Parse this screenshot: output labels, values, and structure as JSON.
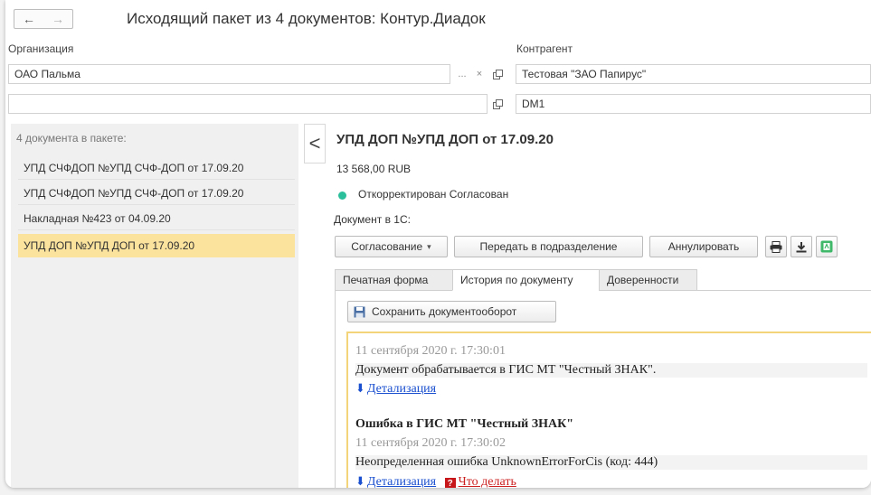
{
  "header": {
    "title": "Исходящий пакет из 4 документов: Контур.Диадок",
    "back_icon": "arrow-left-icon",
    "forward_icon": "arrow-right-icon"
  },
  "organization": {
    "label": "Организация",
    "value": "ОАО Пальма",
    "ellipsis": "...",
    "clear": "×"
  },
  "counterparty": {
    "label": "Контрагент",
    "value": "Тестовая \"ЗАО Папирус\"",
    "second_value": "DM1"
  },
  "package": {
    "header": "4 документа в пакете:",
    "items": [
      {
        "label": "УПД СЧФДОП №УПД СЧФ-ДОП от 17.09.20"
      },
      {
        "label": "УПД СЧФДОП №УПД СЧФ-ДОП от 17.09.20"
      },
      {
        "label": "Накладная  №423 от 04.09.20"
      },
      {
        "label": "УПД ДОП №УПД ДОП от 17.09.20"
      }
    ],
    "collapse": "<"
  },
  "document": {
    "title": "УПД ДОП №УПД ДОП от 17.09.20",
    "amount": "13 568,00  RUB",
    "status": "Откорректирован  Согласован",
    "status_color": "#2bbf9c",
    "doc_1c_label": "Документ в 1С:"
  },
  "toolbar": {
    "approval": "Согласование",
    "transfer": "Передать в подразделение",
    "annul": "Аннулировать",
    "print_icon": "printer-icon",
    "download_icon": "download-icon",
    "green_icon": "document-green-icon"
  },
  "tabs": [
    {
      "label": "Печатная форма"
    },
    {
      "label": "История по документу"
    },
    {
      "label": "Доверенности"
    }
  ],
  "history": {
    "save_button": "Сохранить документооборот",
    "entries": {
      "time1": "11 сентября 2020 г. 17:30:01",
      "text1": "Документ обрабатывается в ГИС МТ \"Честный ЗНАК\".",
      "link1": "Детализация",
      "error_title": "Ошибка в ГИС МТ \"Честный ЗНАК\"",
      "time2": "11 сентября 2020 г. 17:30:02",
      "text2": "Неопределенная ошибка UnknownErrorForCis (код: 444)",
      "link2": "Детализация",
      "link3": "Что делать"
    }
  }
}
